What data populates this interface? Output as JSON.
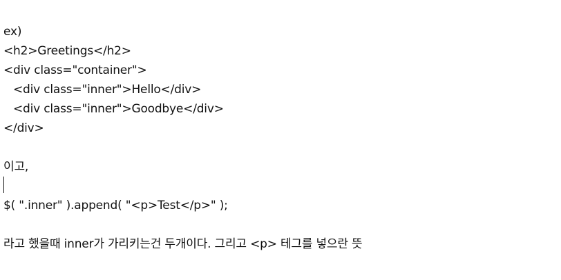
{
  "document": {
    "lines": [
      "ex)",
      "<h2>Greetings</h2>",
      "<div class=\"container\">",
      "<div class=\"inner\">Hello</div>",
      "<div class=\"inner\">Goodbye</div>",
      "</div>",
      "이고,",
      "$( \".inner\" ).append( \"<p>Test</p>\" );",
      "라고 했을때 inner가 가리키는건 두개이다. 그리고 <p> 테그를 넣으란 뜻"
    ]
  }
}
